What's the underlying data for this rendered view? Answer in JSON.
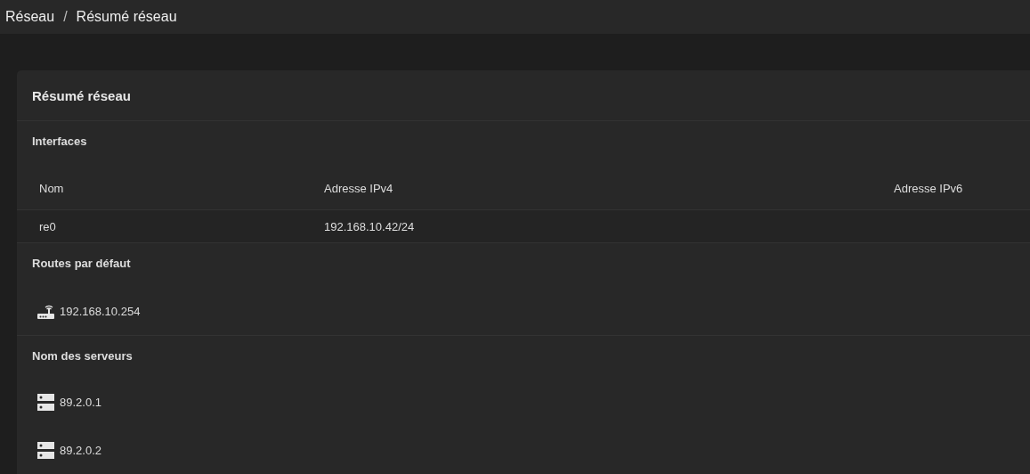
{
  "breadcrumb": [
    "Réseau",
    "Résumé réseau"
  ],
  "breadcrumb_separator": "/",
  "card": {
    "title": "Résumé réseau",
    "interfaces": {
      "title": "Interfaces",
      "columns": [
        "Nom",
        "Adresse IPv4",
        "Adresse IPv6"
      ],
      "rows": [
        [
          "re0",
          "192.168.10.42/24"
        ]
      ]
    },
    "routes": {
      "title": "Routes par défaut",
      "items": [
        "192.168.10.254"
      ]
    },
    "servers": {
      "title": "Nom des serveurs",
      "items": [
        "89.2.0.1",
        "89.2.0.2"
      ]
    }
  }
}
